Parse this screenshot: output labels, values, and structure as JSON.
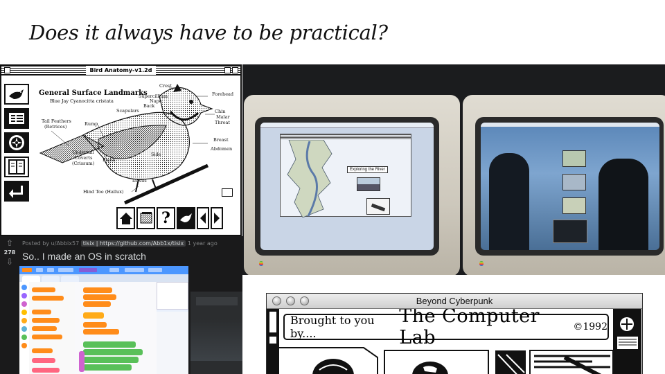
{
  "slide": {
    "title": "Does it always have to be practical?"
  },
  "bird_app": {
    "window_title": "Bird Anatomy-v1.2d",
    "heading": "General Surface Landmarks",
    "subheading": "Blue Jay  Cyanocitta cristata",
    "labels": {
      "crest": "Crest",
      "forehead": "Forehead",
      "supercillium": "Supercillium",
      "nape": "Nape",
      "back": "Back",
      "scapulars": "Scapulars",
      "chin": "Chin",
      "malar": "Malar",
      "throat": "Throat",
      "tail_feathers": "Tail Feathers",
      "retrices": "(Retrices)",
      "rump": "Rump",
      "breast": "Breast",
      "abdomen": "Abdomen",
      "undertail": "Undertail",
      "coverts": "Coverts",
      "crissum": "(Crissum)",
      "flank": "Flank",
      "side": "Side",
      "tarsus": "Tarsus",
      "hind_toe": "Hind Toe (Hallux)"
    }
  },
  "monitors_photo": {
    "left_screen_caption": "Exploring the River"
  },
  "reddit_post": {
    "score": "278",
    "posted_by": "Posted by u/Abbix57",
    "flair": "tisix | https://github.com/Abb1x/tisix",
    "age": "1 year ago",
    "title": "So.. I made an OS in scratch"
  },
  "cyberpunk_app": {
    "window_title": "Beyond Cyberpunk",
    "banner_small": "Brought to you by....",
    "banner_big": "The Computer Lab",
    "banner_year": "©1992"
  }
}
